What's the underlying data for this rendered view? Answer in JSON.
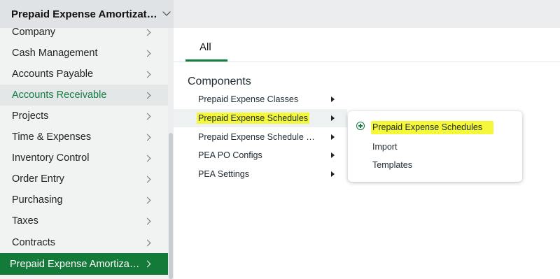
{
  "header": {
    "module_title": "Prepaid Expense Amortizat…"
  },
  "sidebar": {
    "items": [
      {
        "label": "Company"
      },
      {
        "label": "Cash Management"
      },
      {
        "label": "Accounts Payable"
      },
      {
        "label": "Accounts Receivable"
      },
      {
        "label": "Projects"
      },
      {
        "label": "Time & Expenses"
      },
      {
        "label": "Inventory Control"
      },
      {
        "label": "Order Entry"
      },
      {
        "label": "Purchasing"
      },
      {
        "label": "Taxes"
      },
      {
        "label": "Contracts"
      },
      {
        "label": "Prepaid Expense Amortiza…"
      }
    ]
  },
  "main": {
    "tab_all": "All",
    "section_title": "Components",
    "components": [
      {
        "label": "Prepaid Expense Classes"
      },
      {
        "label": "Prepaid Expense Schedules"
      },
      {
        "label": "Prepaid Expense Schedule …"
      },
      {
        "label": "PEA PO Configs"
      },
      {
        "label": "PEA Settings"
      }
    ]
  },
  "flyout": {
    "items": [
      {
        "label": "Prepaid Expense Schedules"
      },
      {
        "label": "Import"
      },
      {
        "label": "Templates"
      }
    ]
  },
  "colors": {
    "accent": "#137c3e",
    "active_bg": "#147a3a",
    "highlight": "#f4f73a"
  },
  "icons": [
    "chevron-down-icon",
    "chevron-right-icon",
    "caret-right-icon",
    "add-circle-icon"
  ]
}
